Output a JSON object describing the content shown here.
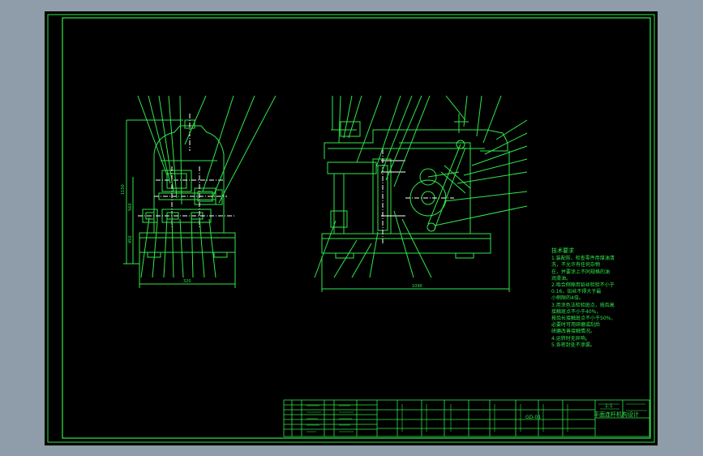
{
  "drawing": {
    "colors": {
      "workspace": "#8f9ca9",
      "sheet": "#000000",
      "line": "#2fe84a",
      "accent": "#ffffff"
    }
  },
  "technical_notes": {
    "heading": "技术要求",
    "lines": [
      "1.装配前、检查零件用煤油清",
      "洗，不允许有任何杂物",
      "在，并要涂上不同规格的油",
      "润滑油。",
      "2.啮合侧隙用铅丝检验不小于",
      "0.16，铅丝不得大于最",
      "小侧隙的4倍。",
      "3.用涂色法检验斑点，按齿高",
      "接触斑点不小于40%，",
      "按齿长接触斑点不小于50%，",
      "必要时可用研磨或刮后",
      "研磨改善接触情况。",
      "4.运转时无异响。",
      "5.各密封处不渗漏。"
    ]
  },
  "dimensions": {
    "front_total_width": "320",
    "front_total_height": "1150",
    "front_mid_height": "560",
    "front_low_height": "450",
    "side_total_width": "1090"
  },
  "title_block": {
    "title": "平面连杆机构设计",
    "scale": "1:1",
    "drawing_no": "GD-01"
  }
}
